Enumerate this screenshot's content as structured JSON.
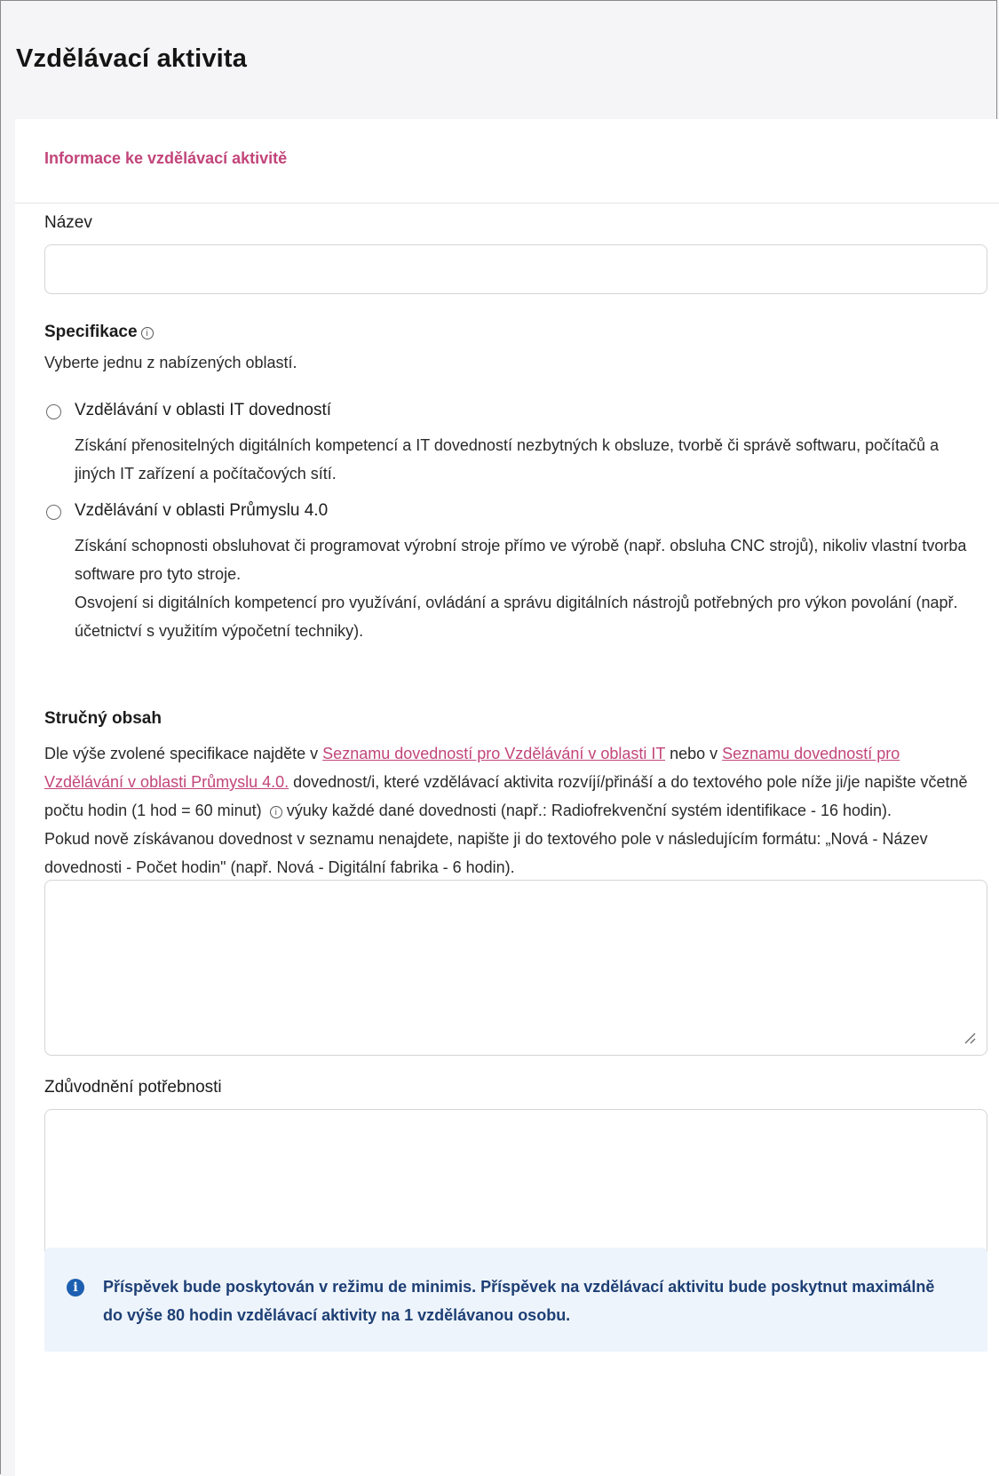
{
  "page": {
    "title": "Vzdělávací aktivita"
  },
  "section": {
    "title": "Informace ke vzdělávací aktivitě"
  },
  "name_field": {
    "label": "Název",
    "value": "",
    "placeholder": ""
  },
  "specification": {
    "label": "Specifikace",
    "help": "Vyberte jednu z nabízených oblastí.",
    "options": [
      {
        "title": "Vzdělávání v oblasti IT dovedností",
        "description": [
          "Získání přenositelných digitálních kompetencí a IT dovedností nezbytných k obsluze, tvorbě či správě softwaru, počítačů a jiných IT zařízení a počítačových sítí."
        ],
        "selected": false
      },
      {
        "title": "Vzdělávání v oblasti Průmyslu 4.0",
        "description": [
          "Získání schopnosti obsluhovat či programovat výrobní stroje přímo ve výrobě (např. obsluha CNC strojů), nikoliv vlastní tvorba software pro tyto stroje.",
          "Osvojení si digitálních kompetencí pro využívání, ovládání a správu digitálních nástrojů potřebných pro výkon povolání (např. účetnictví s využitím výpočetní techniky)."
        ],
        "selected": false
      }
    ]
  },
  "summary": {
    "label": "Stručný obsah",
    "text_before_link1": "Dle výše zvolené specifikace najděte v ",
    "link1": "Seznamu dovedností pro Vzdělávání v oblasti IT",
    "text_between_links": " nebo v ",
    "link2": "Seznamu dovedností pro Vzdělávání v oblasti Průmyslu 4.0.",
    "text_after_link2": " dovednost/i, které vzdělávací aktivita rozvíjí/přináší a do textového pole níže ji/je napište včetně počtu hodin (1 hod = 60 minut)",
    "text_after_icon": " výuky každé dané dovednosti (např.: Radiofrekvenční systém identifikace - 16 hodin).",
    "paragraph2": "Pokud nově získávanou dovednost v seznamu nenajdete, napište ji do textového pole v následujícím formátu: „Nová - Název dovednosti - Počet hodin\" (např. Nová - Digitální fabrika - 6 hodin).",
    "value": ""
  },
  "justification": {
    "label": "Zdůvodnění potřebnosti",
    "value": ""
  },
  "notice": {
    "icon": "info-icon",
    "text": "Příspěvek bude poskytován v režimu de minimis. Příspěvek na vzdělávací aktivitu bude poskytnut maximálně do výše 80 hodin vzdělávací aktivity na 1 vzdělávanou osobu."
  },
  "colors": {
    "accent": "#c2457a",
    "notice_bg": "#eef4fb",
    "notice_text": "#1d3f75",
    "notice_icon": "#1d5fb0"
  }
}
